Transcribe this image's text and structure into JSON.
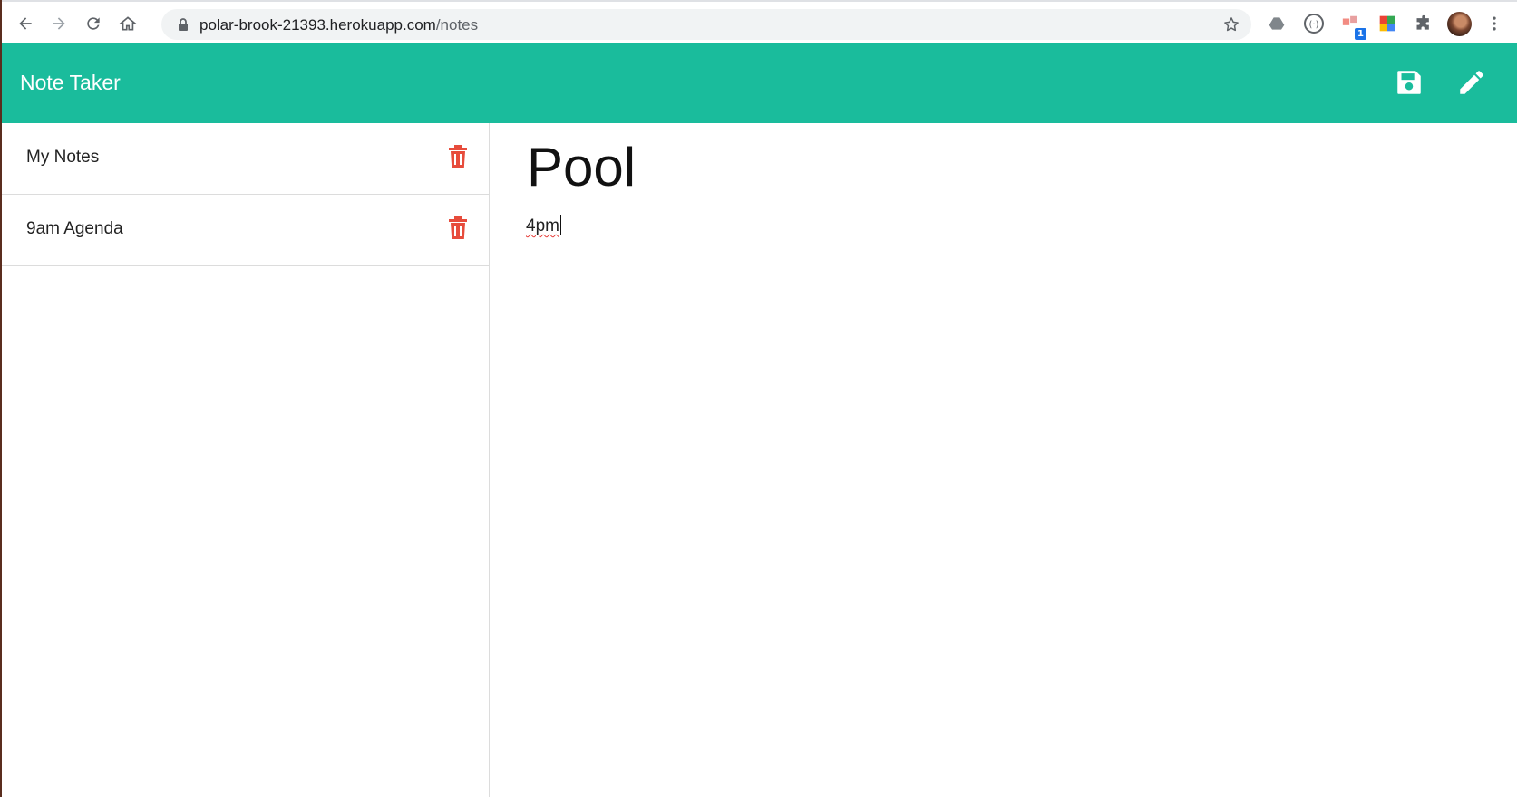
{
  "browser": {
    "url_host": "polar-brook-21393.herokuapp.com",
    "url_path": "/notes",
    "extension_badge": "1",
    "icons": [
      "back-icon",
      "forward-icon",
      "reload-icon",
      "home-icon",
      "lock-icon",
      "star-icon",
      "drive-icon",
      "extension-circle-icon",
      "extension-badge-icon",
      "color-grid-icon",
      "puzzle-icon",
      "avatar",
      "menu-icon"
    ]
  },
  "navbar": {
    "brand": "Note Taker",
    "icons": [
      "save-icon",
      "pencil-icon"
    ],
    "color": "#1abc9c"
  },
  "sidebar": {
    "notes": [
      {
        "title": "My Notes"
      },
      {
        "title": "9am Agenda"
      }
    ],
    "delete_icon": "trash-icon",
    "delete_color": "#e74c3c"
  },
  "editor": {
    "title": "Pool",
    "body": "4pm"
  }
}
